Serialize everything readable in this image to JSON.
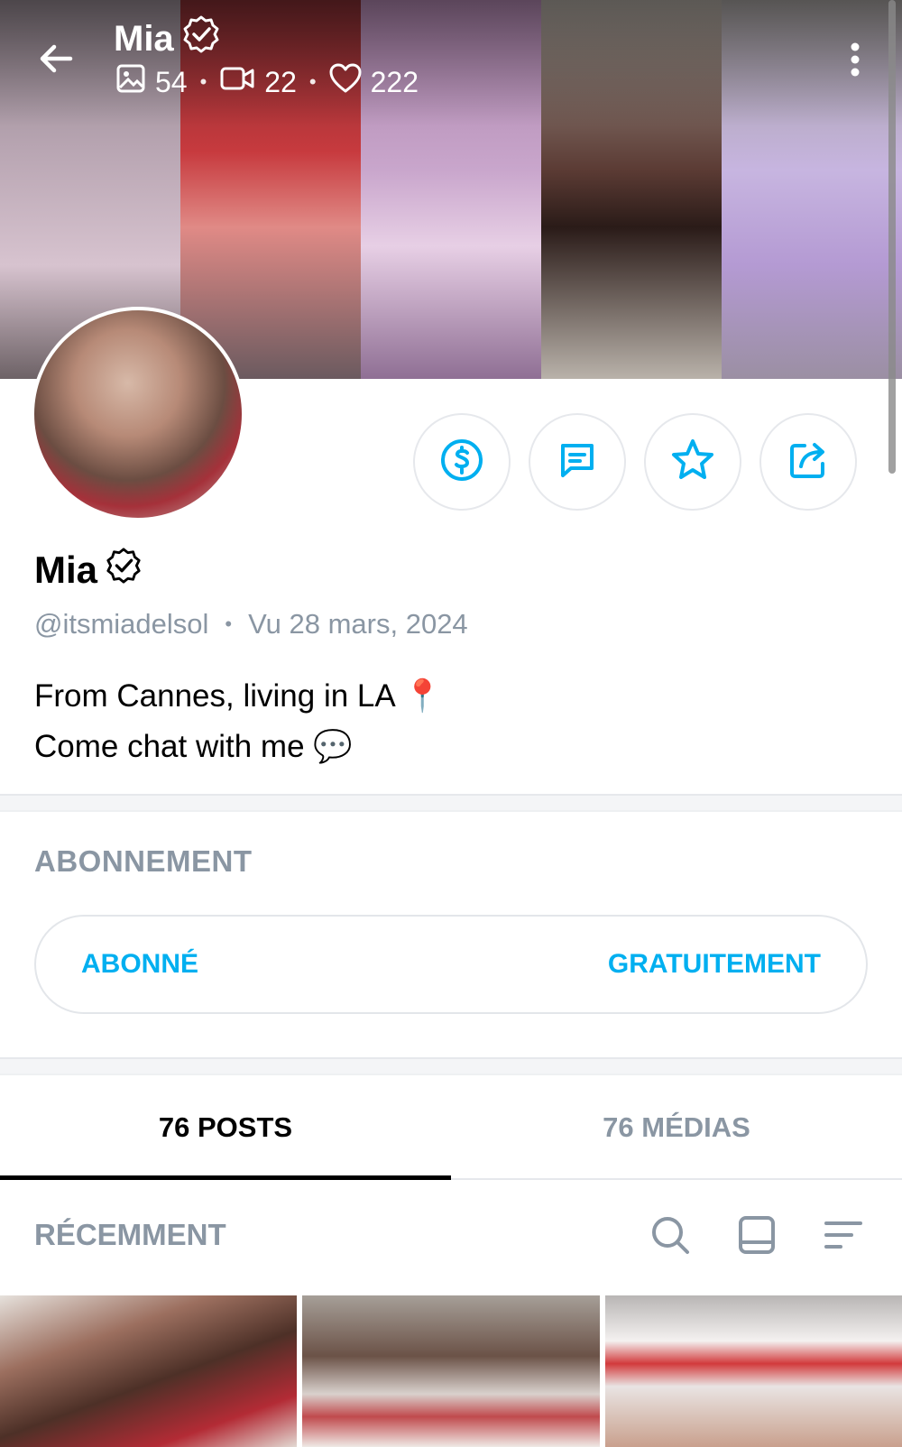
{
  "header": {
    "name": "Mia",
    "stats": {
      "photos": "54",
      "videos": "22",
      "likes": "222"
    }
  },
  "profile": {
    "name": "Mia",
    "handle": "@itsmiadelsol",
    "separator": "•",
    "last_seen": "Vu  28 mars, 2024",
    "bio_line1": "From Cannes, living in LA 📍",
    "bio_line2": "Come chat with me 💬"
  },
  "actions": {
    "icons": [
      "dollar-icon",
      "message-icon",
      "star-icon",
      "share-icon"
    ]
  },
  "subscription": {
    "title": "ABONNEMENT",
    "status_label": "ABONNÉ",
    "price_label": "GRATUITEMENT"
  },
  "tabs": [
    {
      "label": "76 POSTS"
    },
    {
      "label": "76 MÉDIAS"
    }
  ],
  "recent": {
    "title": "RÉCEMMENT",
    "icons": [
      "search-icon",
      "layout-icon",
      "sort-icon"
    ]
  },
  "colors": {
    "accent": "#00aff0",
    "muted": "#8a96a3",
    "border": "#e6e8ec"
  }
}
